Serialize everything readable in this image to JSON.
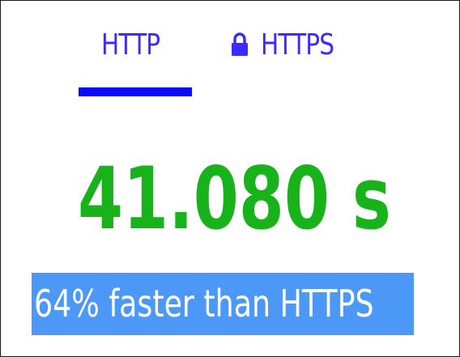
{
  "tabs": {
    "http_label": "HTTP",
    "https_label": "HTTPS",
    "active_tab": "HTTP",
    "https_icon": "lock-icon"
  },
  "result": {
    "time": "41.080 s",
    "comparison": "64% faster than HTTPS"
  },
  "colors": {
    "tab_text": "#3b2bff",
    "active_underline": "#0a0af5",
    "time_text": "#18b31b",
    "banner_background": "#4c98f7",
    "banner_text": "#ffffff",
    "border": "#1a1a1a"
  }
}
